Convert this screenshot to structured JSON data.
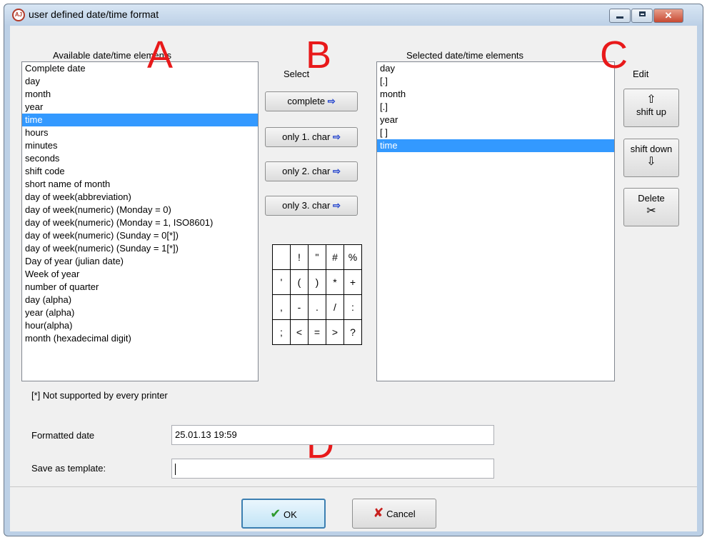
{
  "window": {
    "title": "user defined date/time format",
    "close_label": "✕"
  },
  "markers": [
    "A",
    "B",
    "C",
    "D"
  ],
  "available": {
    "label": "Available date/time elements",
    "items": [
      "Complete date",
      "day",
      "month",
      "year",
      "time",
      "hours",
      "minutes",
      "seconds",
      "shift code",
      "short name of month",
      "day of week(abbreviation)",
      "day of week(numeric) (Monday = 0)",
      "day of week(numeric) (Monday = 1, ISO8601)",
      "day of week(numeric) (Sunday = 0[*])",
      "day of week(numeric) (Sunday = 1[*])",
      "Day of year (julian date)",
      "Week of year",
      "number of quarter",
      "day (alpha)",
      "year (alpha)",
      "hour(alpha)",
      "month (hexadecimal digit)"
    ],
    "selected_index": 4,
    "footnote": "[*] Not supported by every printer"
  },
  "select": {
    "label": "Select",
    "buttons": [
      "complete",
      "only 1. char",
      "only 2. char",
      "only 3. char"
    ],
    "arrow": "⇨",
    "chars": [
      [
        " ",
        "!",
        "\"",
        "#",
        "%"
      ],
      [
        "'",
        "(",
        ")",
        "*",
        "+"
      ],
      [
        ",",
        "-",
        ".",
        "/",
        ":"
      ],
      [
        ";",
        "<",
        "=",
        ">",
        "?"
      ]
    ]
  },
  "selected": {
    "label": "Selected date/time elements",
    "items": [
      "day",
      "[.]",
      "month",
      "[.]",
      "year",
      "[ ]",
      "time"
    ],
    "selected_index": 6
  },
  "edit": {
    "label": "Edit",
    "shift_up": "shift up",
    "shift_up_icon": "⇧",
    "shift_down": "shift down",
    "shift_down_icon": "⇩",
    "delete": "Delete",
    "delete_icon": "✂"
  },
  "formatted": {
    "label": "Formatted date",
    "value": "25.01.13 19:59"
  },
  "template": {
    "label": "Save as template:",
    "value": ""
  },
  "footer": {
    "ok": "OK",
    "ok_icon": "✔",
    "cancel": "Cancel",
    "cancel_icon": "✘"
  },
  "colors": {
    "selection": "#3399ff",
    "marker": "#e8191a",
    "arrow": "#1a3ccc"
  }
}
